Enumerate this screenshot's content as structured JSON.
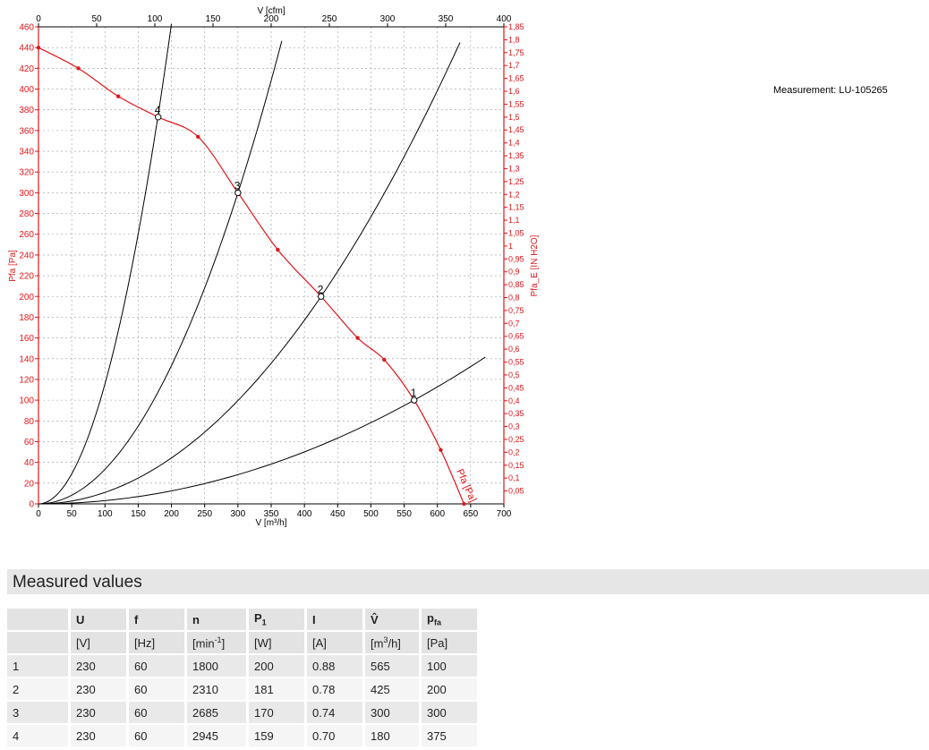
{
  "measurement_note": "Measurement: LU-105265",
  "chart_data": {
    "type": "line",
    "title": "",
    "xlabel": "V [m³/h]",
    "x2label": "V [cfm]",
    "ylabel": "Pfa [Pa]",
    "y2label": "Pfa_E [IN H2O]",
    "xlim": [
      0,
      700
    ],
    "ylim": [
      0,
      460
    ],
    "x2lim": [
      0,
      400
    ],
    "y2lim": [
      0,
      1.85
    ],
    "x_ticks": [
      "0",
      "50",
      "100",
      "150",
      "200",
      "250",
      "300",
      "350",
      "400",
      "450",
      "500",
      "550",
      "600",
      "650",
      "700"
    ],
    "y_ticks": [
      "0",
      "20",
      "40",
      "60",
      "80",
      "100",
      "120",
      "140",
      "160",
      "180",
      "200",
      "220",
      "240",
      "260",
      "280",
      "300",
      "320",
      "340",
      "360",
      "380",
      "400",
      "420",
      "440",
      "460"
    ],
    "x2_ticks": [
      "0",
      "50",
      "100",
      "150",
      "200",
      "250",
      "300",
      "350",
      "400"
    ],
    "y2_ticks": [
      "0,05",
      "0,1",
      "0,15",
      "0,2",
      "0,25",
      "0,3",
      "0,35",
      "0,4",
      "0,45",
      "0,5",
      "0,55",
      "0,6",
      "0,65",
      "0,7",
      "0,75",
      "0,8",
      "0,85",
      "0,9",
      "0,95",
      "1",
      "1,05",
      "1,1",
      "1,15",
      "1,2",
      "1,25",
      "1,3",
      "1,35",
      "1,4",
      "1,45",
      "1,5",
      "1,55",
      "1,6",
      "1,65",
      "1,7",
      "1,75",
      "1,8",
      "1,85"
    ],
    "grid": true,
    "fan_curve": {
      "label": "Pfa [Pa]",
      "color": "#e0161b",
      "x": [
        0,
        60,
        120,
        180,
        240,
        300,
        360,
        425,
        480,
        520,
        565,
        605,
        640
      ],
      "y": [
        440,
        420,
        393,
        373,
        354,
        300,
        245,
        200,
        160,
        139,
        100,
        52,
        0
      ]
    },
    "system_curves": [
      {
        "k": 0.0003133,
        "xmax": 672
      },
      {
        "k": 0.001107,
        "xmax": 634
      },
      {
        "k": 0.003333,
        "xmax": 366
      },
      {
        "k": 0.011574,
        "xmax": 200
      }
    ],
    "points": [
      {
        "label": "1",
        "x": 565,
        "y": 100
      },
      {
        "label": "2",
        "x": 425,
        "y": 200
      },
      {
        "label": "3",
        "x": 300,
        "y": 300
      },
      {
        "label": "4",
        "x": 180,
        "y": 373
      }
    ]
  },
  "measured_values": {
    "title": "Measured values",
    "headers": [
      "U",
      "f",
      "n",
      "P1",
      "I",
      "V",
      "pfa"
    ],
    "units": [
      "[V]",
      "[Hz]",
      "[min-1]",
      "[W]",
      "[A]",
      "[m3/h]",
      "[Pa]"
    ],
    "rows": [
      [
        "1",
        "230",
        "60",
        "1800",
        "200",
        "0.88",
        "565",
        "100"
      ],
      [
        "2",
        "230",
        "60",
        "2310",
        "181",
        "0.78",
        "425",
        "200"
      ],
      [
        "3",
        "230",
        "60",
        "2685",
        "170",
        "0.74",
        "300",
        "300"
      ],
      [
        "4",
        "230",
        "60",
        "2945",
        "159",
        "0.70",
        "180",
        "375"
      ]
    ]
  }
}
